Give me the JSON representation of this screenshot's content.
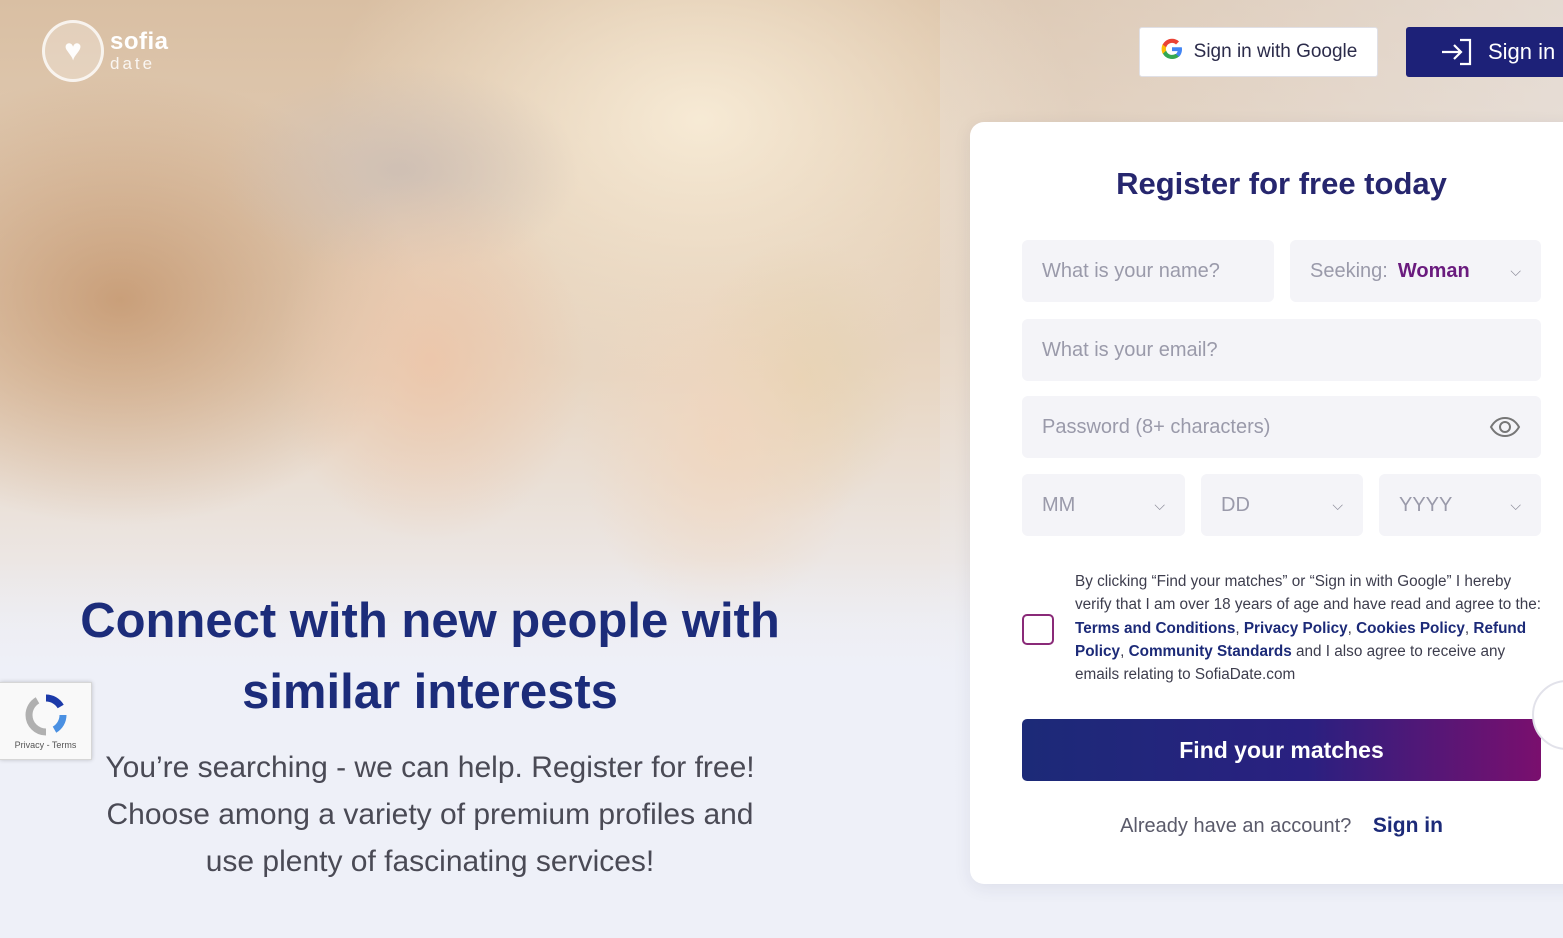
{
  "brand": {
    "name": "sofia",
    "sub": "date"
  },
  "header": {
    "google_button": "Sign in with Google",
    "signin_button": "Sign in"
  },
  "hero": {
    "headline_line1": "Connect with new people with",
    "headline_line2": "similar interests",
    "sub_line1": "You’re searching - we can help. Register for free!",
    "sub_line2": "Choose among a variety of premium profiles and",
    "sub_line3": "use plenty of fascinating services!"
  },
  "recaptcha": {
    "links": "Privacy - Terms"
  },
  "register": {
    "title": "Register for free today",
    "name_placeholder": "What is your name?",
    "seeking_label": "Seeking:",
    "seeking_value": "Woman",
    "email_placeholder": "What is your email?",
    "password_placeholder": "Password (8+ characters)",
    "month_placeholder": "MM",
    "day_placeholder": "DD",
    "year_placeholder": "YYYY",
    "terms_intro": "By clicking “Find your matches” or “Sign in with Google” I hereby verify that I am over 18 years of age and have read and agree to the:",
    "terms_link": "Terms and Conditions",
    "privacy_link": "Privacy Policy",
    "cookies_link": "Cookies Policy",
    "refund_link": "Refund Policy",
    "community_link": "Community Standards",
    "terms_outro": "and I also agree to receive any emails relating to SofiaDate.com",
    "submit": "Find your matches",
    "already": "Already have an account?",
    "signin_link": "Sign in"
  },
  "colors": {
    "primary": "#1c2a78",
    "accent": "#7a0f6e",
    "seeking": "#6a1b7e"
  }
}
